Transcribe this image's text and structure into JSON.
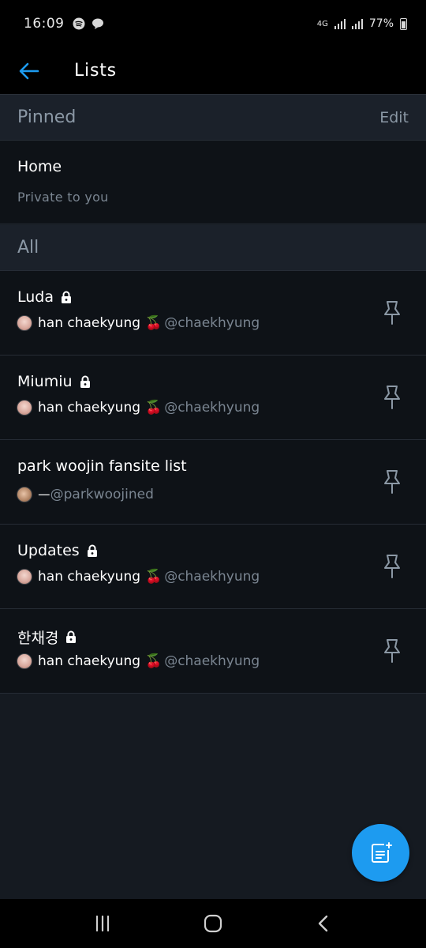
{
  "status_bar": {
    "time": "16:09",
    "network": "4G",
    "battery": "77%"
  },
  "header": {
    "title": "Lists",
    "back_icon": "arrow-left-icon"
  },
  "pinned_section": {
    "title": "Pinned",
    "edit_label": "Edit",
    "items": [
      {
        "name": "Home",
        "subtitle": "Private to you"
      }
    ]
  },
  "all_section": {
    "title": "All",
    "lists": [
      {
        "name": "Luda",
        "private": true,
        "owner_name": "han chaekyung",
        "owner_emoji": "🍒",
        "owner_handle": "@chaekhyung"
      },
      {
        "name": "Miumiu",
        "private": true,
        "owner_name": "han chaekyung",
        "owner_emoji": "🍒",
        "owner_handle": "@chaekhyung"
      },
      {
        "name": "park woojin fansite list",
        "private": false,
        "owner_name": "ㅡ",
        "owner_emoji": "",
        "owner_handle": "@parkwoojined"
      },
      {
        "name": "Updates",
        "private": true,
        "owner_name": "han chaekyung",
        "owner_emoji": "🍒",
        "owner_handle": "@chaekhyung"
      },
      {
        "name": "한채경",
        "private": true,
        "owner_name": "han chaekyung",
        "owner_emoji": "🍒",
        "owner_handle": "@chaekhyung"
      }
    ]
  },
  "fab": {
    "icon": "new-list-icon"
  },
  "colors": {
    "accent": "#1d9bf0",
    "background": "#151a21",
    "row_background": "#0e1217",
    "muted_text": "#8b98a5"
  }
}
